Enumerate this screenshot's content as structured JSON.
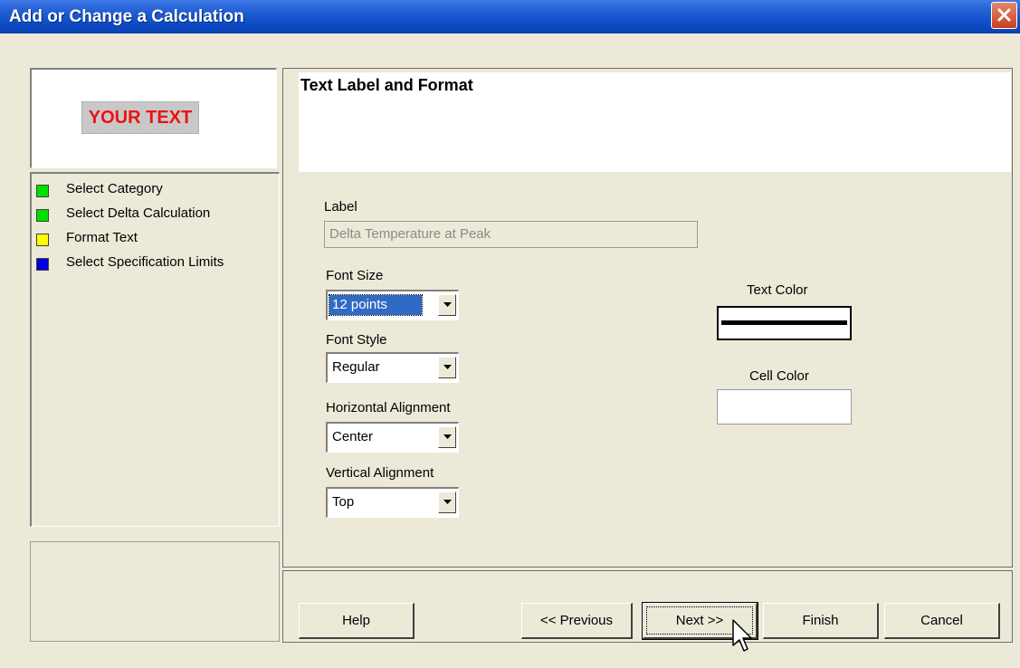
{
  "window": {
    "title": "Add or Change a Calculation"
  },
  "preview": {
    "text": "YOUR TEXT"
  },
  "steps": [
    {
      "label": "Select Category",
      "color": "#00e000"
    },
    {
      "label": "Select Delta Calculation",
      "color": "#00e000"
    },
    {
      "label": "Format Text",
      "color": "#ffff00"
    },
    {
      "label": "Select Specification Limits",
      "color": "#0000e0"
    }
  ],
  "panel": {
    "title": "Text Label and Format"
  },
  "form": {
    "label_caption": "Label",
    "label_value": "Delta Temperature at Peak",
    "font_size_caption": "Font Size",
    "font_size_value": "12 points",
    "font_style_caption": "Font Style",
    "font_style_value": "Regular",
    "h_align_caption": "Horizontal Alignment",
    "h_align_value": "Center",
    "v_align_caption": "Vertical Alignment",
    "v_align_value": "Top",
    "text_color_caption": "Text Color",
    "cell_color_caption": "Cell Color"
  },
  "buttons": {
    "help": "Help",
    "previous": "<< Previous",
    "next": "Next >>",
    "finish": "Finish",
    "cancel": "Cancel"
  }
}
